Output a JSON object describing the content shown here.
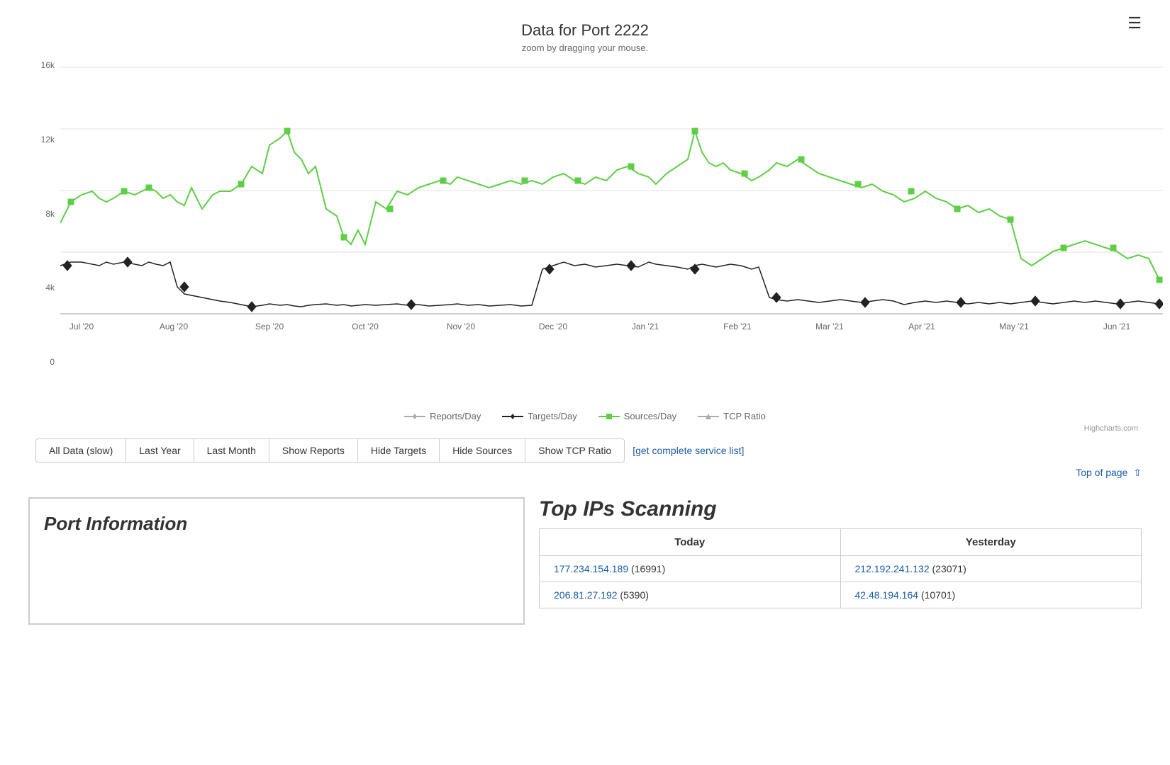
{
  "page": {
    "title": "Data for Port 2222",
    "subtitle": "zoom by dragging your mouse.",
    "highcharts_credit": "Highcharts.com"
  },
  "chart": {
    "y_axis_labels": [
      "16k",
      "12k",
      "8k",
      "4k",
      "0"
    ],
    "x_axis_labels": [
      "Jul '20",
      "Aug '20",
      "Sep '20",
      "Oct '20",
      "Nov '20",
      "Dec '20",
      "Jan '21",
      "Feb '21",
      "Mar '21",
      "Apr '21",
      "May '21",
      "Jun '21"
    ],
    "legend": [
      {
        "id": "reports-day",
        "label": "Reports/Day",
        "color": "#aaa",
        "shape": "diamond"
      },
      {
        "id": "targets-day",
        "label": "Targets/Day",
        "color": "#111",
        "shape": "diamond"
      },
      {
        "id": "sources-day",
        "label": "Sources/Day",
        "color": "#5fce47",
        "shape": "square"
      },
      {
        "id": "tcp-ratio",
        "label": "TCP Ratio",
        "color": "#aaa",
        "shape": "triangle"
      }
    ]
  },
  "buttons": [
    {
      "id": "all-data",
      "label": "All Data (slow)"
    },
    {
      "id": "last-year",
      "label": "Last Year"
    },
    {
      "id": "last-month",
      "label": "Last Month"
    },
    {
      "id": "show-reports",
      "label": "Show Reports"
    },
    {
      "id": "hide-targets",
      "label": "Hide Targets"
    },
    {
      "id": "hide-sources",
      "label": "Hide Sources"
    },
    {
      "id": "show-tcp-ratio",
      "label": "Show TCP Ratio"
    }
  ],
  "service_link": {
    "label": "[get complete service list]",
    "href": "#"
  },
  "top_of_page": {
    "label": "Top of page"
  },
  "port_information": {
    "title": "Port Information"
  },
  "top_ips": {
    "title": "Top IPs Scanning",
    "columns": [
      "Today",
      "Yesterday"
    ],
    "rows": [
      {
        "today_ip": "177.234.154.189",
        "today_count": "(16991)",
        "yesterday_ip": "212.192.241.132",
        "yesterday_count": "(23071)"
      },
      {
        "today_ip": "206.81.27.192",
        "today_count": "(5390)",
        "yesterday_ip": "42.48.194.164",
        "yesterday_count": "(10701)"
      }
    ]
  }
}
